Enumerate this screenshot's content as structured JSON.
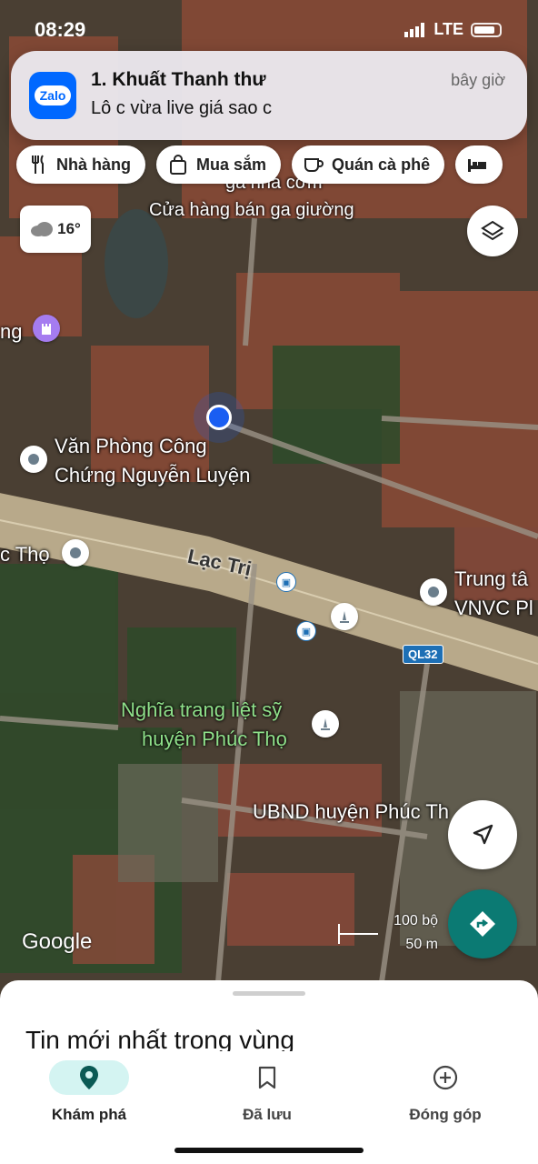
{
  "status_bar": {
    "time": "08:29",
    "network": "LTE"
  },
  "notification": {
    "app": "Zalo",
    "title": "1. Khuất Thanh thư",
    "time": "bây giờ",
    "body": "Lô c vừa live giá sao c"
  },
  "chips": [
    {
      "label": "Nhà hàng",
      "icon": "fork-knife-icon"
    },
    {
      "label": "Mua sắm",
      "icon": "shopping-bag-icon"
    },
    {
      "label": "Quán cà phê",
      "icon": "coffee-cup-icon"
    },
    {
      "label": "",
      "icon": "bed-icon"
    }
  ],
  "weather": {
    "temp": "16°",
    "icon": "cloud-icon"
  },
  "map": {
    "labels": {
      "ga_nha_com": "ga nha cơm",
      "cua_hang": "Cửa hàng bán ga giường",
      "ng": "ng",
      "van_phong_1": "Văn Phòng Công",
      "van_phong_2": "Chứng Nguyễn Luyện",
      "c_tho": "c Thọ",
      "lac_tri": "Lạc Trị",
      "trung_ta_1": "Trung tâ",
      "trung_ta_2": "VNVC Pl",
      "ql32": "QL32",
      "nghia_trang_1": "Nghĩa trang liệt sỹ",
      "nghia_trang_2": "huyện Phúc Thọ",
      "ubnd": "UBND huyện Phúc Th"
    },
    "attribution": "Google",
    "scale": {
      "imperial": "100 bộ",
      "metric": "50 m"
    }
  },
  "sheet": {
    "title": "Tin mới nhất trong vùng"
  },
  "bottom_nav": [
    {
      "label": "Khám phá",
      "icon": "location-pin-icon",
      "active": true
    },
    {
      "label": "Đã lưu",
      "icon": "bookmark-icon",
      "active": false
    },
    {
      "label": "Đóng góp",
      "icon": "add-circle-icon",
      "active": false
    }
  ],
  "colors": {
    "accent": "#0b7a73",
    "nav_active_bg": "#d4f4f2",
    "user_dot": "#1a5ef2"
  }
}
